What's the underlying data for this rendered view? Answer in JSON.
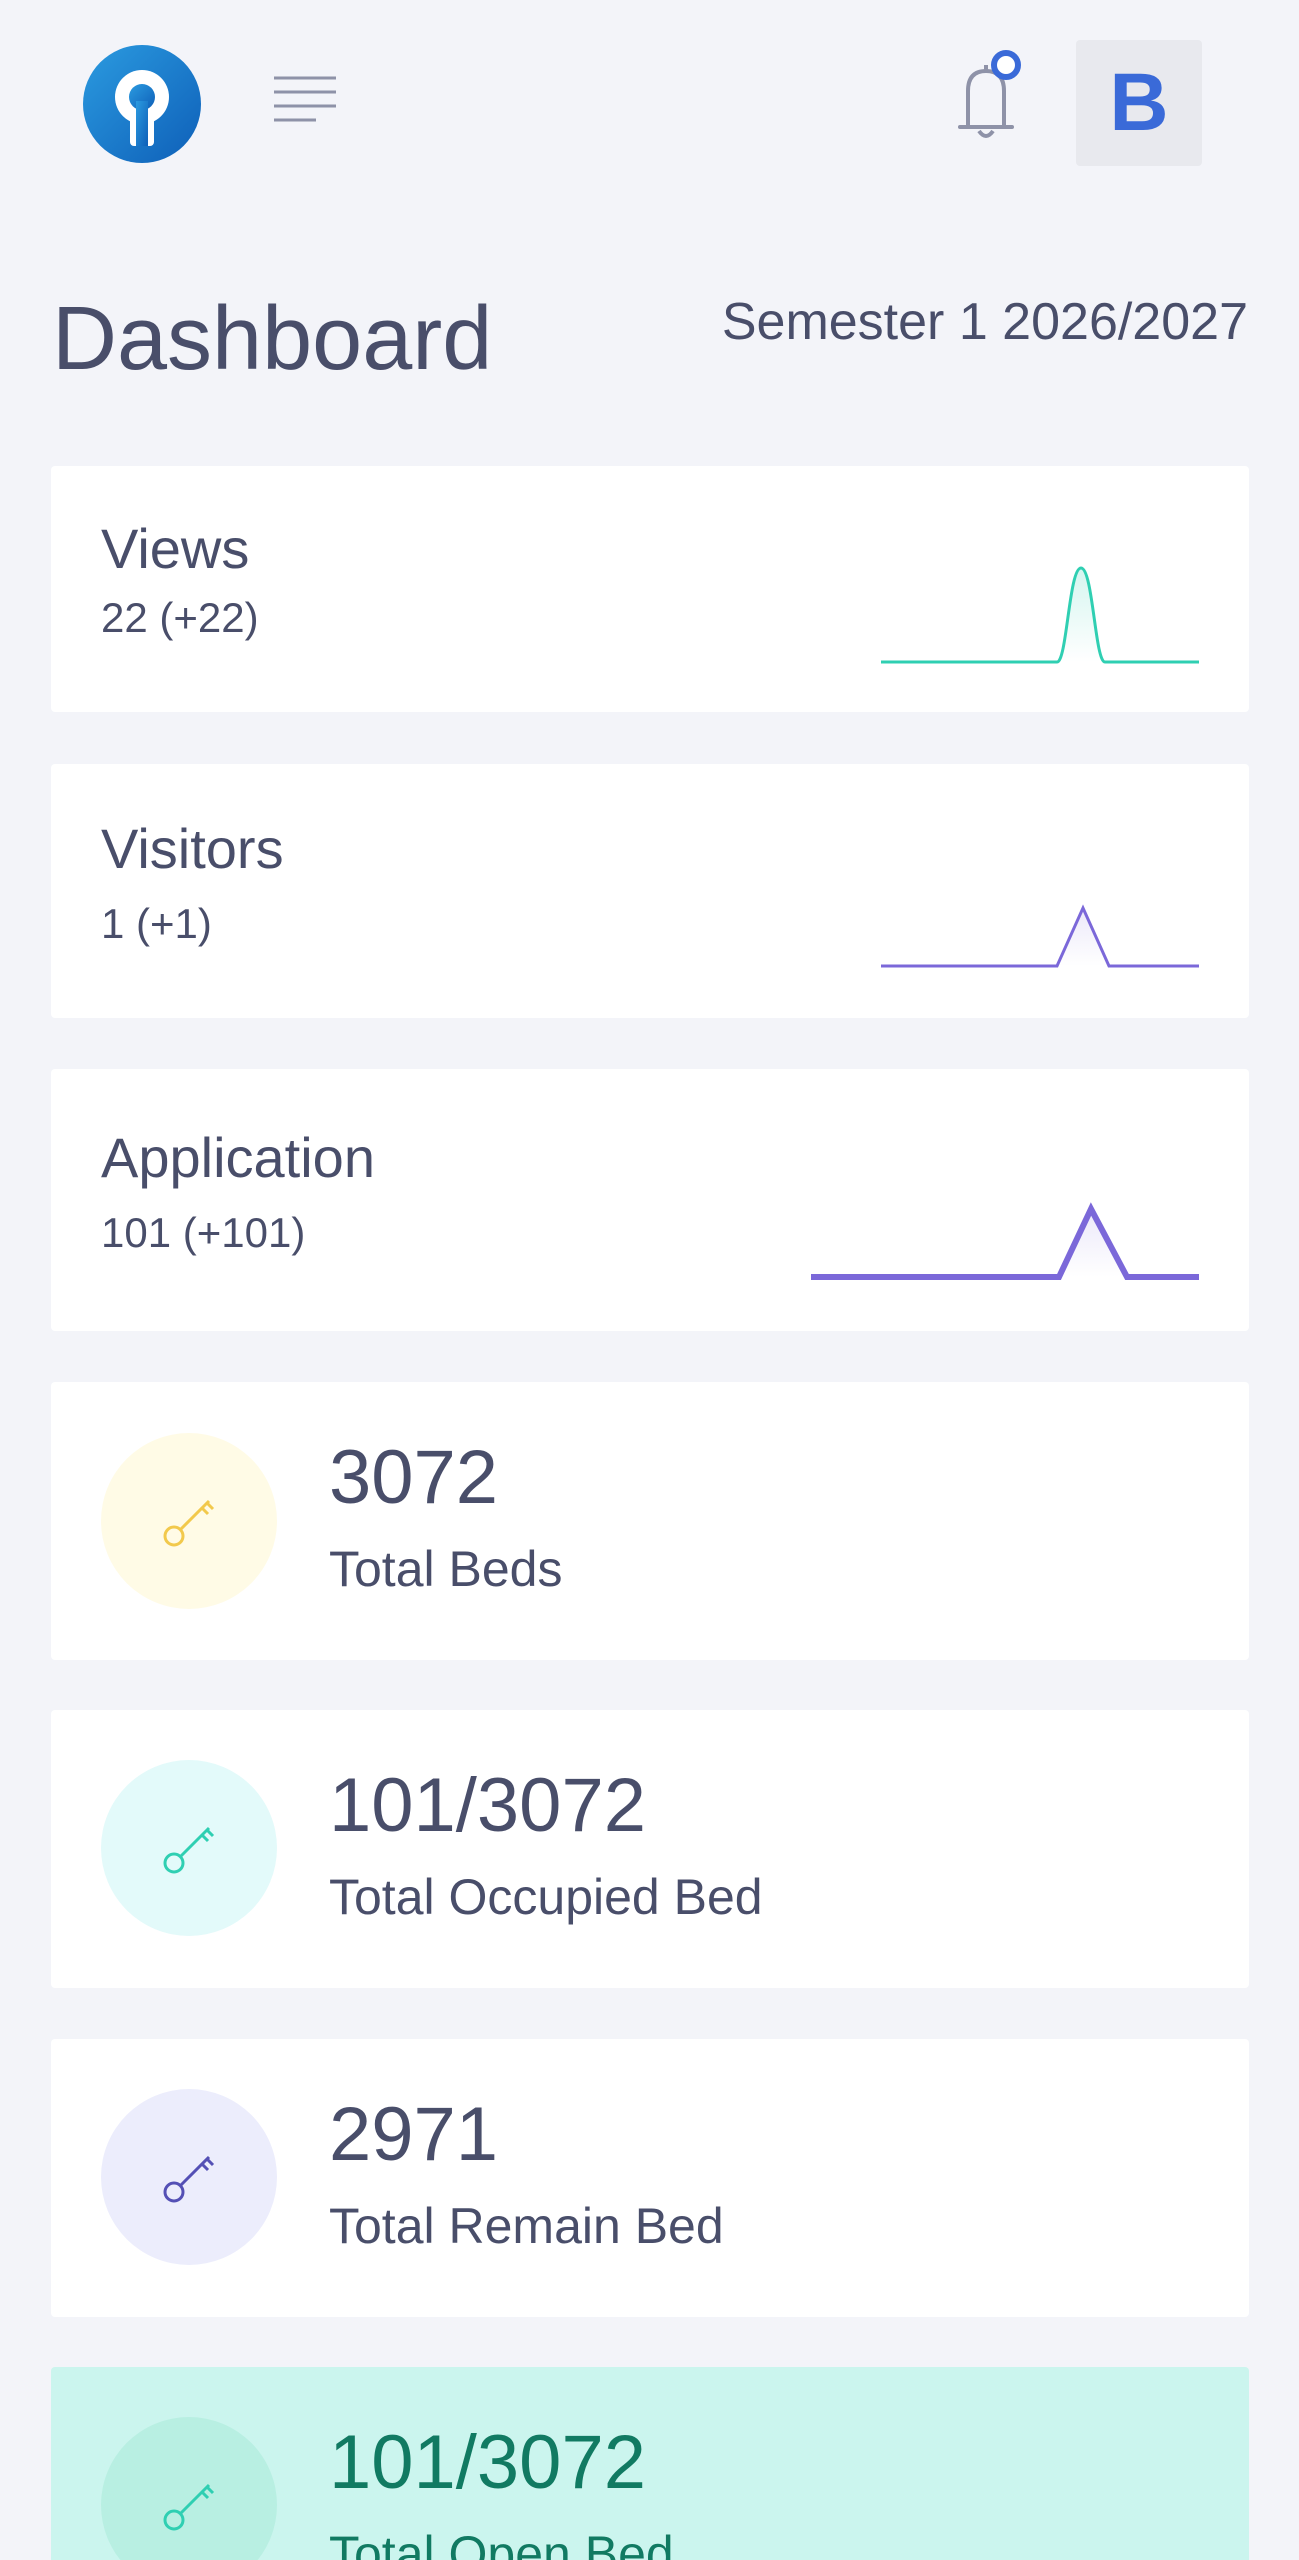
{
  "header": {
    "avatar_letter": "B",
    "logo_icon": "logo-icon",
    "menu_icon": "hamburger-icon",
    "bell_icon": "bell-icon"
  },
  "page": {
    "title": "Dashboard",
    "semester": "Semester 1 2026/2027"
  },
  "stats": [
    {
      "label": "Views",
      "value": "22 (+22)",
      "color": "#2fcfb2"
    },
    {
      "label": "Visitors",
      "value": "1 (+1)",
      "color": "#7b68d9"
    },
    {
      "label": "Application",
      "value": "101 (+101)",
      "color": "#7b68d9"
    }
  ],
  "beds": [
    {
      "value": "3072",
      "label": "Total Beds",
      "icon": "key-icon",
      "icon_color": "#f2c94c",
      "bg": "#fffbe6"
    },
    {
      "value": "101/3072",
      "label": "Total Occupied Bed",
      "icon": "key-icon",
      "icon_color": "#2fcfb2",
      "bg": "#e3fafa"
    },
    {
      "value": "2971",
      "label": "Total Remain Bed",
      "icon": "key-icon",
      "icon_color": "#5450b5",
      "bg": "#ecedfc"
    },
    {
      "value": "101/3072",
      "label": "Total Open Bed",
      "icon": "key-icon",
      "icon_color": "#2fcfb2",
      "bg": "#b8efe2"
    }
  ],
  "colors": {
    "background": "#f3f4f9",
    "accent": "#3a6ad8",
    "text": "#494e6a",
    "highlight_card": "#cbf5ee",
    "highlight_text": "#117a62"
  }
}
